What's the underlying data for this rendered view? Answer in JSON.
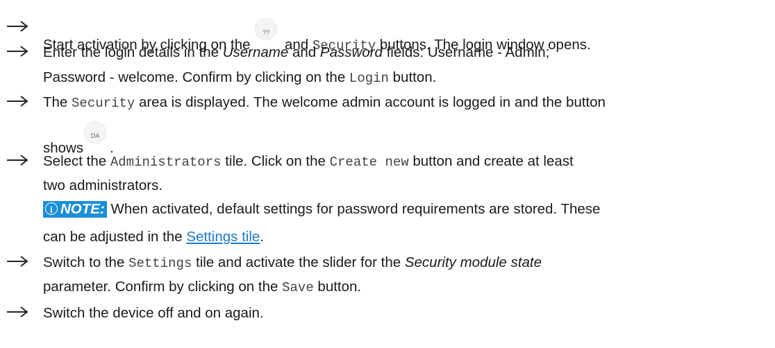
{
  "steps": [
    {
      "s1a": "Start activation by clicking on the",
      "icon_label": "??",
      "s1b": "and",
      "s1code": "Security",
      "s1c": "buttons. The login window opens."
    },
    {
      "s2a": "Enter the login details in the",
      "s2u": "Username",
      "s2b": "and",
      "s2p": "Password",
      "s2c": "fields: Username - Admin;",
      "s2d": "Password - welcome. Confirm by clicking on the",
      "s2code": "Login",
      "s2e": "button."
    },
    {
      "s3a": "The",
      "s3code": "Security",
      "s3b": "area is displayed. The welcome admin account is logged in and the button",
      "s3c": "shows",
      "icon_label": "DA",
      "s3d": "."
    },
    {
      "s4a": "Select the",
      "s4code1": "Administrators",
      "s4b": "tile. Click on the",
      "s4code2": "Create new",
      "s4c": "button and create at least",
      "s4d": "two administrators.",
      "note_label": "NOTE:",
      "note_text": "When activated, default settings for password requirements are stored. These",
      "note_text2": "can be adjusted in the",
      "note_link": "Settings tile",
      "note_end": "."
    },
    {
      "s5a": "Switch to the",
      "s5code": "Settings",
      "s5b": "tile and activate the slider for the",
      "s5i": "Security module state",
      "s5c": "parameter. Confirm by clicking on the",
      "s5code2": "Save",
      "s5d": "button."
    },
    {
      "s6a": "Switch the device off and on again."
    }
  ],
  "icons": {
    "arrow": "right-arrow-icon",
    "info": "info-icon"
  },
  "colors": {
    "note_bg": "#1a8ed8",
    "link": "#1a7ac8"
  }
}
